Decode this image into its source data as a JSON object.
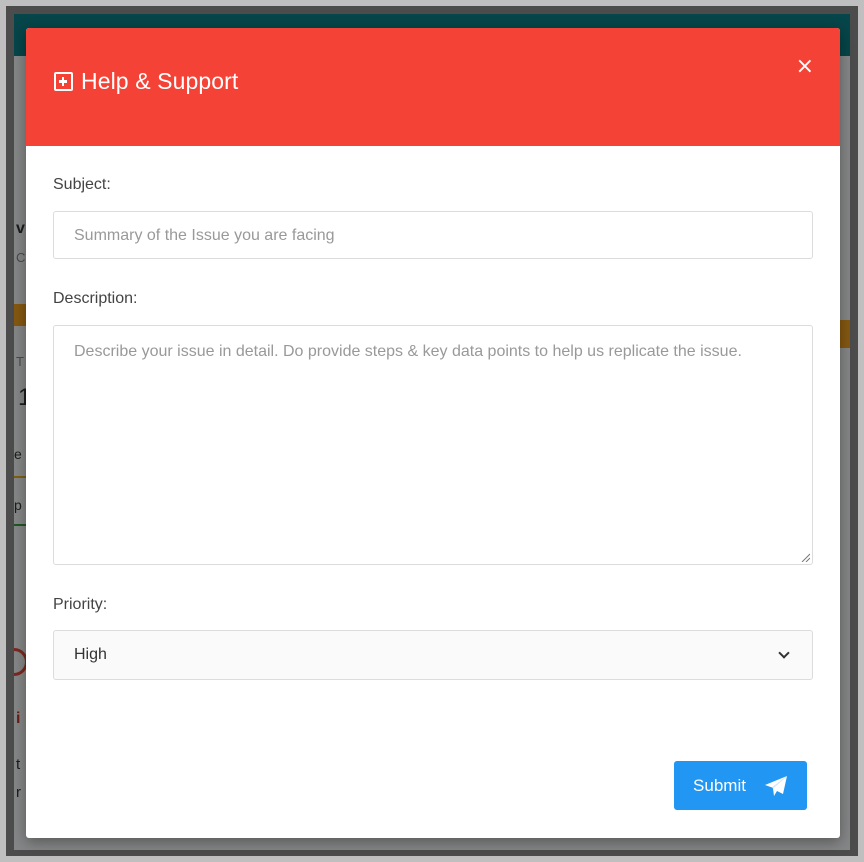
{
  "modal": {
    "title": "Help & Support",
    "close_label": "×",
    "subject": {
      "label": "Subject:",
      "placeholder": "Summary of the Issue you are facing",
      "value": ""
    },
    "description": {
      "label": "Description:",
      "placeholder": "Describe your issue in detail. Do provide steps & key data points to help us replicate the issue.",
      "value": ""
    },
    "priority": {
      "label": "Priority:",
      "selected": "High"
    },
    "submit_label": "Submit"
  },
  "background_fragments": [
    "v",
    "C",
    "T",
    "1",
    "e",
    "p",
    "i",
    "t",
    "r"
  ],
  "colors": {
    "header": "#f44336",
    "submit": "#2196f3",
    "topbar": "#0c7f86"
  }
}
